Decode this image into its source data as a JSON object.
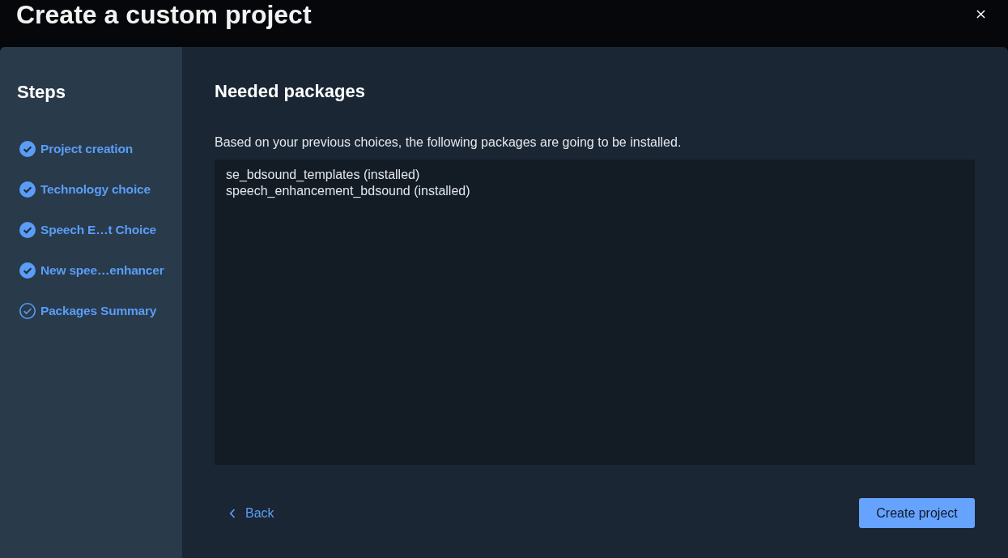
{
  "window": {
    "title": "Create a custom project"
  },
  "sidebar": {
    "title": "Steps",
    "items": [
      {
        "label": "Project creation",
        "completed": true
      },
      {
        "label": "Technology choice",
        "completed": true
      },
      {
        "label": "Speech E…t Choice",
        "completed": true
      },
      {
        "label": "New spee…enhancer",
        "completed": true
      },
      {
        "label": "Packages Summary",
        "completed": false
      }
    ]
  },
  "main": {
    "title": "Needed packages",
    "description": "Based on your previous choices, the following packages are going to be installed.",
    "packages": [
      "se_bdsound_templates (installed)",
      "speech_enhancement_bdsound (installed)"
    ]
  },
  "footer": {
    "back": "Back",
    "primary": "Create project"
  }
}
